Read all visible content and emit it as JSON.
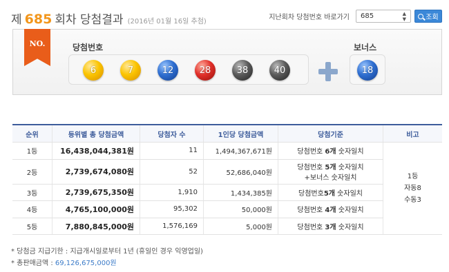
{
  "header": {
    "title_prefix": "제",
    "round": "685",
    "title_suffix": "회차 당첨결과",
    "draw_date": "(2016년 01월 16일 추첨)",
    "goto_label": "지난회차 당첨번호 바로가기",
    "select_value": "685",
    "search_label": "조회"
  },
  "result": {
    "badge": "NO.",
    "winning_label": "당첨번호",
    "bonus_label": "보너스",
    "numbers": [
      {
        "value": "6",
        "color": "yellow"
      },
      {
        "value": "7",
        "color": "yellow"
      },
      {
        "value": "12",
        "color": "blue"
      },
      {
        "value": "28",
        "color": "red"
      },
      {
        "value": "38",
        "color": "gray"
      },
      {
        "value": "40",
        "color": "gray"
      }
    ],
    "bonus": {
      "value": "18",
      "color": "blue"
    }
  },
  "table": {
    "headers": [
      "순위",
      "등위별 총 당첨금액",
      "당첨자 수",
      "1인당 당첨금액",
      "당첨기준",
      "비고"
    ],
    "rows": [
      {
        "rank": "1등",
        "total": "16,438,044,381원",
        "winners": "11",
        "per": "1,494,367,671원",
        "crit_a": "당첨번호 ",
        "crit_b": "6개",
        "crit_c": " 숫자일치",
        "crit2": ""
      },
      {
        "rank": "2등",
        "total": "2,739,674,080원",
        "winners": "52",
        "per": "52,686,040원",
        "crit_a": "당첨번호 ",
        "crit_b": "5개",
        "crit_c": " 숫자일치",
        "crit2": "+보너스 숫자일치"
      },
      {
        "rank": "3등",
        "total": "2,739,675,350원",
        "winners": "1,910",
        "per": "1,434,385원",
        "crit_a": "당첨번호",
        "crit_b": "5개",
        "crit_c": " 숫자일치",
        "crit2": ""
      },
      {
        "rank": "4등",
        "total": "4,765,100,000원",
        "winners": "95,302",
        "per": "50,000원",
        "crit_a": "당첨번호 ",
        "crit_b": "4개",
        "crit_c": " 숫자일치",
        "crit2": ""
      },
      {
        "rank": "5등",
        "total": "7,880,845,000원",
        "winners": "1,576,169",
        "per": "5,000원",
        "crit_a": "당첨번호 ",
        "crit_b": "3개",
        "crit_c": " 숫자일치",
        "crit2": ""
      }
    ],
    "note_lines": [
      "1등",
      "자동8",
      "수동3"
    ]
  },
  "footer": {
    "note1": "* 당첨금 지급기한 : 지급개시일로부터 1년 (휴일인 경우 익영업일)",
    "note2_label": "* 총판매금액 : ",
    "note2_value": "69,126,675,000원"
  }
}
